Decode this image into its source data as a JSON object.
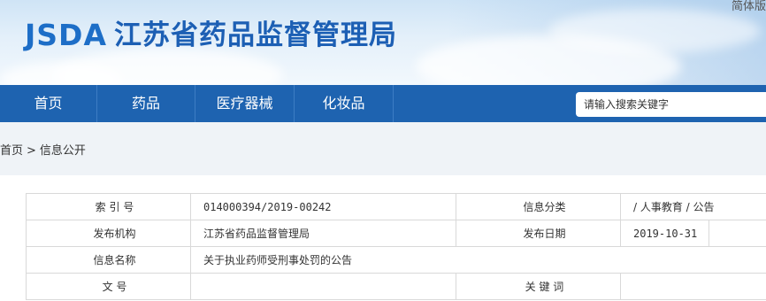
{
  "header": {
    "logo_mark": "JSDA",
    "site_title": "江苏省药品监督管理局",
    "language_link": "简体版"
  },
  "nav": {
    "items": [
      {
        "label": "首页"
      },
      {
        "label": "药品"
      },
      {
        "label": "医疗器械"
      },
      {
        "label": "化妆品"
      }
    ],
    "search_placeholder": "请输入搜索关键字"
  },
  "breadcrumb": {
    "home": "首页",
    "separator": ">",
    "current": "信息公开"
  },
  "info_table": {
    "index_label": "索 引 号",
    "index_value": "014000394/2019-00242",
    "category_label": "信息分类",
    "category_value": "/ 人事教育 / 公告",
    "publisher_label": "发布机构",
    "publisher_value": "江苏省药品监督管理局",
    "date_label": "发布日期",
    "date_value": "2019-10-31",
    "name_label": "信息名称",
    "name_value": "关于执业药师受刑事处罚的公告",
    "doc_no_label": "文 号",
    "doc_no_value": "",
    "keywords_label": "关 键 词",
    "keywords_value": ""
  }
}
